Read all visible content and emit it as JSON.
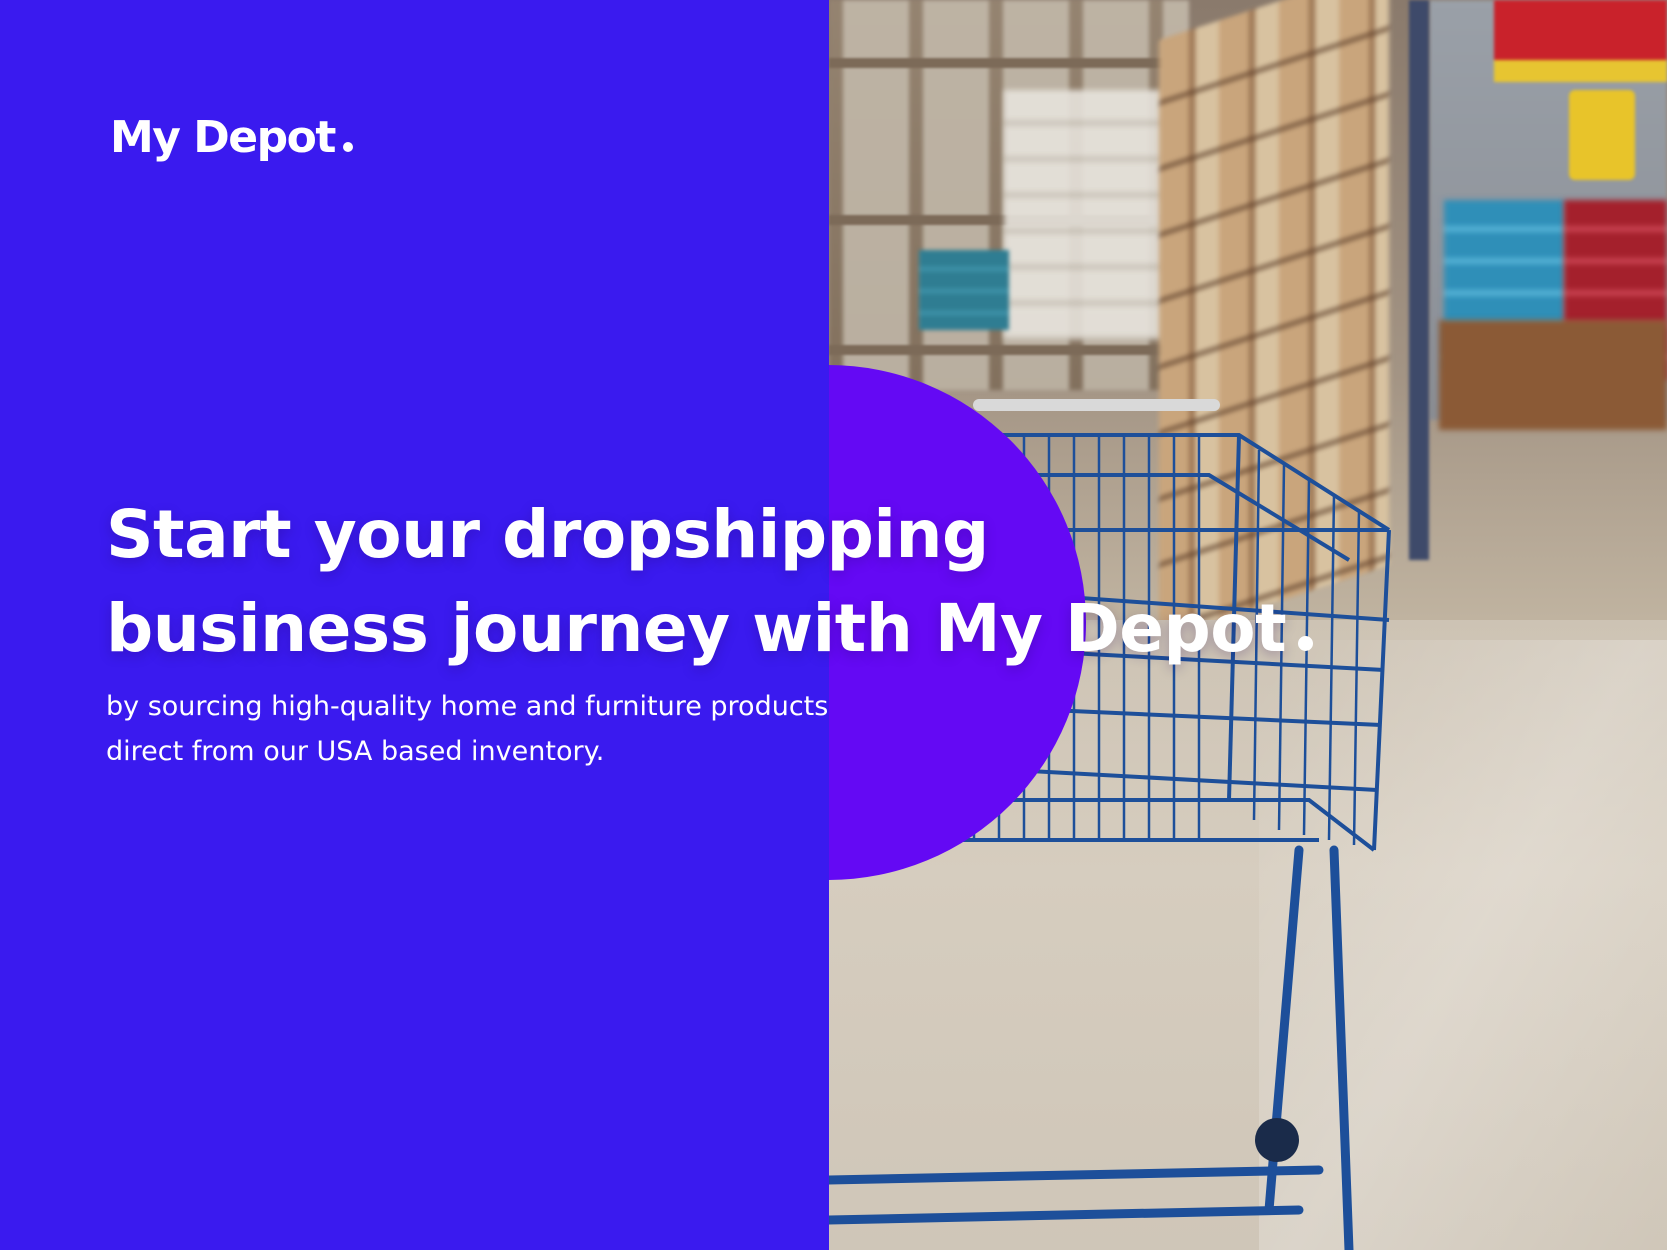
{
  "brand": {
    "logo_text": "My Depot",
    "logo_dot": "."
  },
  "hero": {
    "headline_line1": "Start your dropshipping",
    "headline_line2_prefix": "business journey with",
    "headline_brand": "My Depot",
    "subtitle_line1": "by sourcing high-quality home and furniture products",
    "subtitle_line2": "direct from our USA based inventory."
  },
  "colors": {
    "background": "#3a1aef",
    "accent_circle": "#6409f4",
    "text": "#ffffff"
  },
  "image": {
    "subject": "shopping-cart-in-warehouse-aisle-photo"
  }
}
